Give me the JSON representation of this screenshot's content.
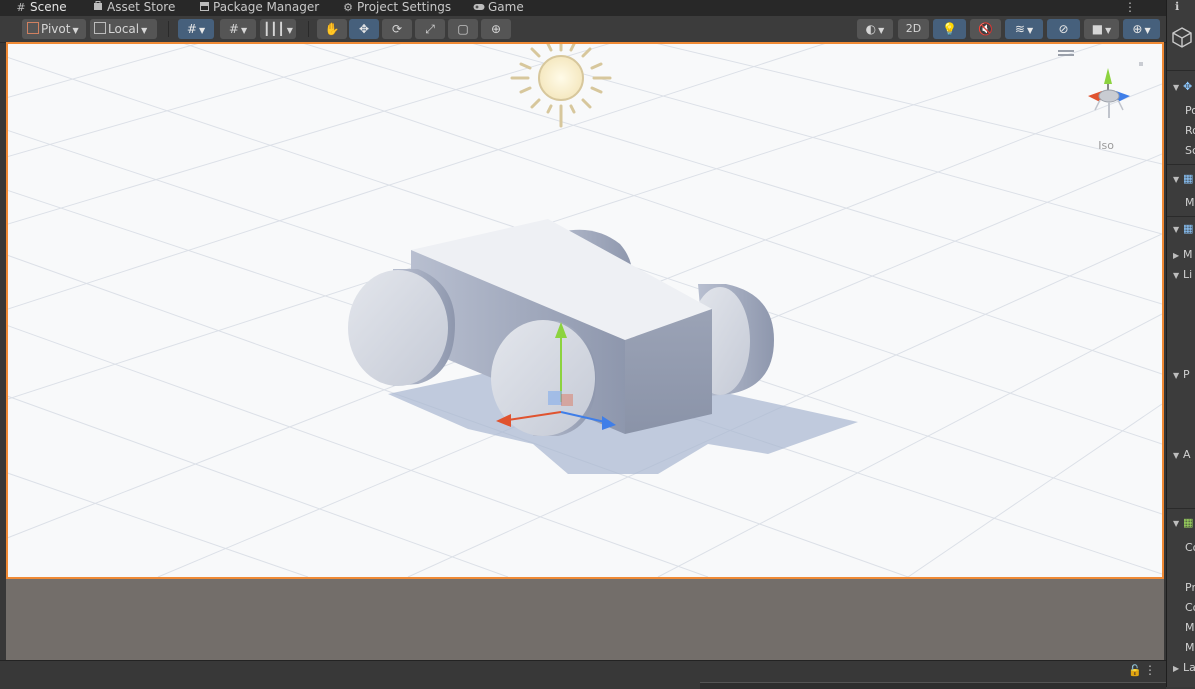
{
  "tabs": [
    {
      "label": "Scene",
      "icon": "hash-icon"
    },
    {
      "label": "Asset Store",
      "icon": "bag-icon"
    },
    {
      "label": "Package Manager",
      "icon": "box-icon"
    },
    {
      "label": "Project Settings",
      "icon": "gear-icon"
    },
    {
      "label": "Game",
      "icon": "gamepad-icon"
    }
  ],
  "toolbar": {
    "pivot_label": "Pivot",
    "local_label": "Local",
    "mode_2d_label": "2D"
  },
  "gizmo": {
    "projection_label": "Iso",
    "colors": {
      "x": "#e0532f",
      "y": "#8cd33f",
      "z": "#3f7ee8"
    }
  },
  "viewport": {
    "selection_border_color": "#f08a35",
    "below_fill_color": "#736e6a"
  },
  "inspector": {
    "header_icon": "cube-icon",
    "rows": [
      {
        "tri": "",
        "label": "Po"
      },
      {
        "tri": "",
        "label": "Ro"
      },
      {
        "tri": "",
        "label": "Sc"
      },
      {
        "tri": "",
        "label": "Me"
      },
      {
        "tri": "▶",
        "label": "M"
      },
      {
        "tri": "▼",
        "label": "Li"
      },
      {
        "tri": "▼",
        "label": "P"
      },
      {
        "tri": "▼",
        "label": "A"
      },
      {
        "tri": "",
        "label": "Co"
      },
      {
        "tri": "",
        "label": "Pr"
      },
      {
        "tri": "",
        "label": "Co"
      },
      {
        "tri": "",
        "label": "M"
      },
      {
        "tri": "",
        "label": "M"
      },
      {
        "tri": "▶",
        "label": "La"
      }
    ]
  }
}
